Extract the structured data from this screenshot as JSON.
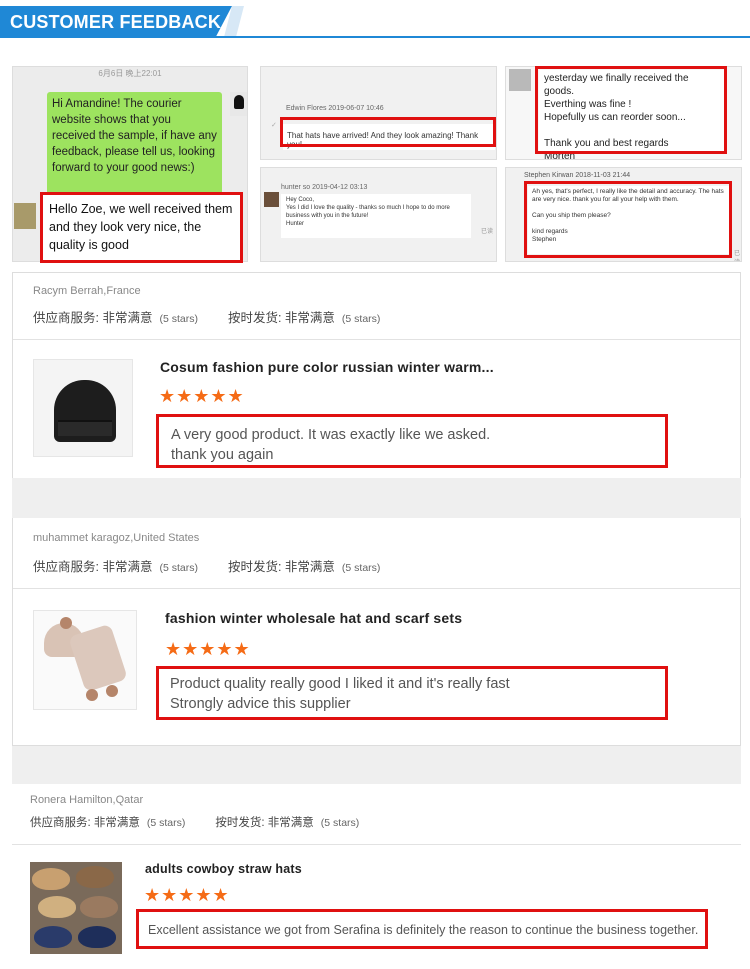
{
  "header": {
    "title": "CUSTOMER FEEDBACK"
  },
  "chats": {
    "c1": {
      "timestamp": "6月6日 晚上22:01",
      "seller_message": "Hi Amandine!\nThe courier website shows that you received the sample, if have any feedback, please tell us, looking forward to your good news:)",
      "buyer_message": "Hello Zoe, we well received them and they look very nice, the quality is good"
    },
    "c2": {
      "meta": "Edwin Flores  2019-06-07 10:46",
      "message": "That hats have arrived! And they look amazing! Thank you!"
    },
    "c3": {
      "message": "yesterday we finally received the goods.\nEverthing was fine !\nHopefully us can reorder soon...\n\nThank you and best regards\nMorten"
    },
    "c4": {
      "meta": "hunter so  2019-04-12 03:13",
      "message": "Hey Coco,\nYes I did I love the quality - thanks so much I hope to do more\nbusiness with you in the future!\nHunter",
      "mark": "已读"
    },
    "c5": {
      "meta": "Stephen Kirwan  2018-11-03 21:44",
      "message": "Ah yes, that's perfect, I really like the detail and accuracy. The hats are very nice. thank you for all your help with them.\n\nCan you ship them please?\n\nkind regards\nStephen",
      "mark": "已读"
    }
  },
  "reviews": [
    {
      "reviewer": "Racym Berrah,France",
      "service_label": "供应商服务: 非常满意",
      "service_count": "(5 stars)",
      "delivery_label": "按时发货: 非常满意",
      "delivery_count": "(5 stars)",
      "product_title": "Cosum fashion pure color russian winter warm...",
      "stars": "★★★★★",
      "rating": 5,
      "text": "A very good product. It was exactly like we asked.\nthank you again"
    },
    {
      "reviewer": "muhammet karagoz,United States",
      "service_label": "供应商服务: 非常满意",
      "service_count": "(5 stars)",
      "delivery_label": "按时发货: 非常满意",
      "delivery_count": "(5 stars)",
      "product_title": "fashion winter wholesale hat and scarf sets",
      "stars": "★★★★★",
      "rating": 5,
      "text": "Product quality really good I liked it and it's really fast\nStrongly advice this supplier"
    },
    {
      "reviewer": "Ronera Hamilton,Qatar",
      "service_label": "供应商服务: 非常满意",
      "service_count": "(5 stars)",
      "delivery_label": "按时发货: 非常满意",
      "delivery_count": "(5 stars)",
      "product_title": "adults cowboy straw hats",
      "stars": "★★★★★",
      "rating": 5,
      "text": "Excellent assistance we got from Serafina is definitely the reason to continue the business together."
    }
  ],
  "colors": {
    "accent": "#1f88d6",
    "highlight": "#e01010",
    "star": "#f56b16",
    "chat_green": "#9de35f"
  }
}
